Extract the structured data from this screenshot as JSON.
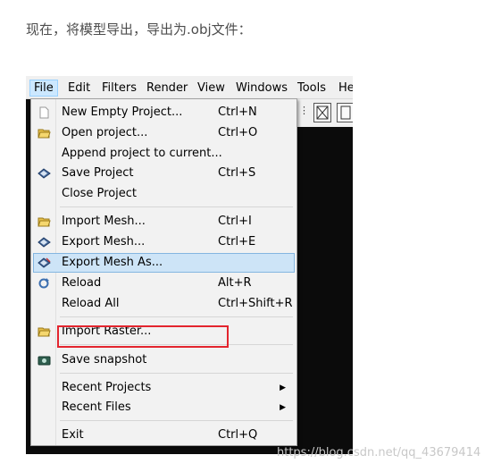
{
  "caption": "现在，将模型导出，导出为.obj文件：",
  "menubar": [
    "File",
    "Edit",
    "Filters",
    "Render",
    "View",
    "Windows",
    "Tools",
    "He"
  ],
  "menu": {
    "new_empty_project": {
      "label": "New Empty Project...",
      "shortcut": "Ctrl+N"
    },
    "open_project": {
      "label": "Open project...",
      "shortcut": "Ctrl+O"
    },
    "append_project": {
      "label": "Append project to current...",
      "shortcut": ""
    },
    "save_project": {
      "label": "Save Project",
      "shortcut": "Ctrl+S"
    },
    "close_project": {
      "label": "Close Project",
      "shortcut": ""
    },
    "import_mesh": {
      "label": "Import Mesh...",
      "shortcut": "Ctrl+I"
    },
    "export_mesh": {
      "label": "Export Mesh...",
      "shortcut": "Ctrl+E"
    },
    "export_mesh_as": {
      "label": "Export Mesh As...",
      "shortcut": ""
    },
    "reload": {
      "label": "Reload",
      "shortcut": "Alt+R"
    },
    "reload_all": {
      "label": "Reload All",
      "shortcut": "Ctrl+Shift+R"
    },
    "import_raster": {
      "label": "Import Raster...",
      "shortcut": ""
    },
    "save_snapshot": {
      "label": "Save snapshot",
      "shortcut": ""
    },
    "recent_projects": {
      "label": "Recent Projects",
      "arrow": "▶"
    },
    "recent_files": {
      "label": "Recent Files",
      "arrow": "▶"
    },
    "exit": {
      "label": "Exit",
      "shortcut": "Ctrl+Q"
    }
  },
  "watermark": "https://blog.csdn.net/qq_43679414",
  "colors": {
    "highlight": "#cde4f7",
    "annotation_box": "#e3252e",
    "viewport": "#0b0b0b"
  }
}
